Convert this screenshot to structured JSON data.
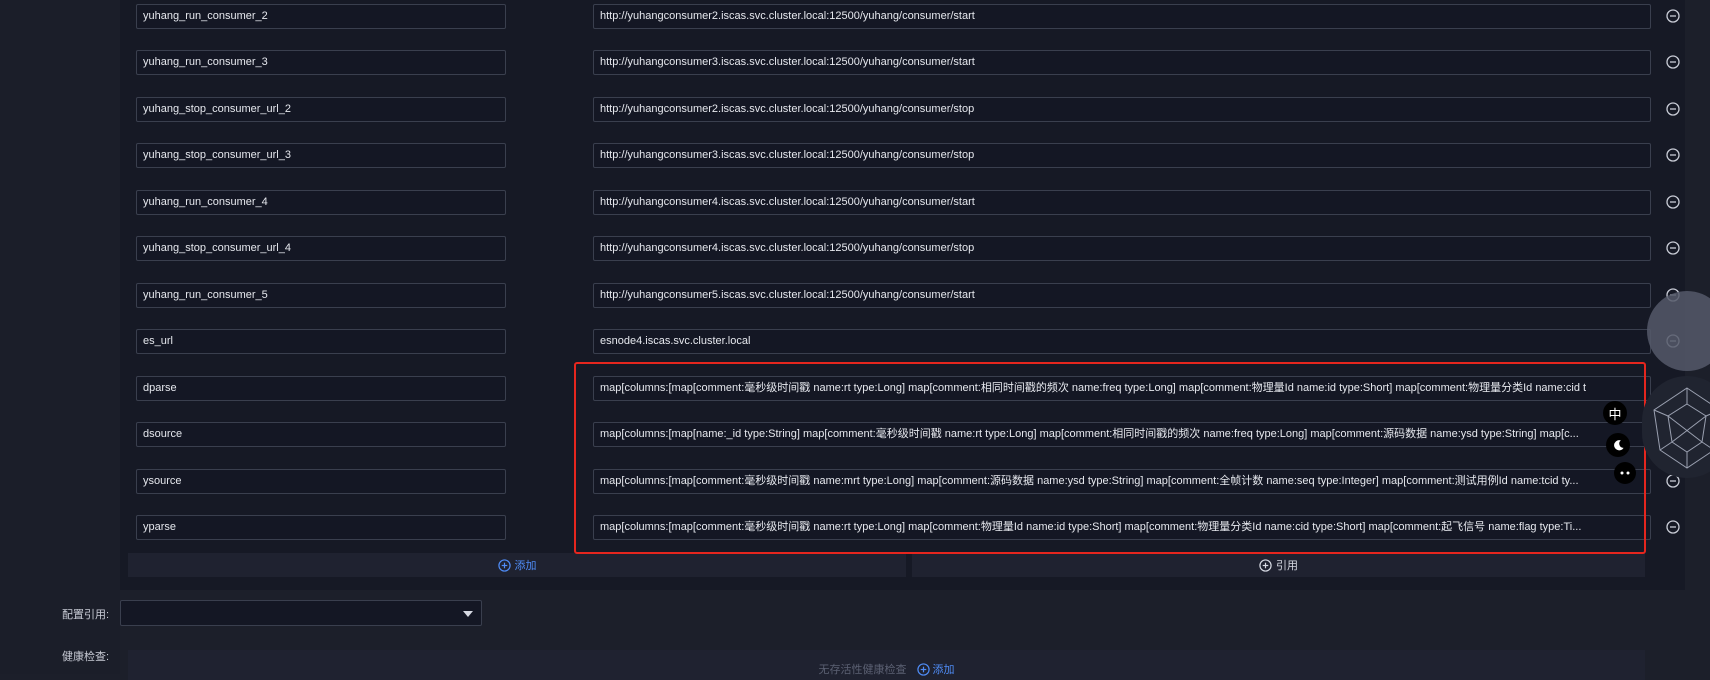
{
  "variables": [
    {
      "key": "yuhang_run_consumer_2",
      "value": "http://yuhangconsumer2.iscas.svc.cluster.local:12500/yuhang/consumer/start"
    },
    {
      "key": "yuhang_run_consumer_3",
      "value": "http://yuhangconsumer3.iscas.svc.cluster.local:12500/yuhang/consumer/start"
    },
    {
      "key": "yuhang_stop_consumer_url_2",
      "value": "http://yuhangconsumer2.iscas.svc.cluster.local:12500/yuhang/consumer/stop"
    },
    {
      "key": "yuhang_stop_consumer_url_3",
      "value": "http://yuhangconsumer3.iscas.svc.cluster.local:12500/yuhang/consumer/stop"
    },
    {
      "key": "yuhang_run_consumer_4",
      "value": "http://yuhangconsumer4.iscas.svc.cluster.local:12500/yuhang/consumer/start"
    },
    {
      "key": "yuhang_stop_consumer_url_4",
      "value": "http://yuhangconsumer4.iscas.svc.cluster.local:12500/yuhang/consumer/stop"
    },
    {
      "key": "yuhang_run_consumer_5",
      "value": "http://yuhangconsumer5.iscas.svc.cluster.local:12500/yuhang/consumer/start"
    },
    {
      "key": "es_url",
      "value": "esnode4.iscas.svc.cluster.local"
    },
    {
      "key": "dparse",
      "value": "map[columns:[map[comment:毫秒级时间戳 name:rt type:Long] map[comment:相同时间戳的频次 name:freq type:Long] map[comment:物理量Id name:id type:Short] map[comment:物理量分类Id name:cid t"
    },
    {
      "key": "dsource",
      "value": "map[columns:[map[name:_id type:String] map[comment:毫秒级时间戳 name:rt type:Long] map[comment:相同时间戳的频次 name:freq type:Long] map[comment:源码数据 name:ysd type:String] map[c..."
    },
    {
      "key": "ysource",
      "value": "map[columns:[map[comment:毫秒级时间戳 name:mrt type:Long] map[comment:源码数据 name:ysd type:String] map[comment:全帧计数 name:seq type:Integer] map[comment:测试用例Id name:tcid ty..."
    },
    {
      "key": "yparse",
      "value": "map[columns:[map[comment:毫秒级时间戳 name:rt type:Long] map[comment:物理量Id name:id type:Short] map[comment:物理量分类Id name:cid type:Short] map[comment:起飞信号 name:flag type:Ti..."
    }
  ],
  "actions": {
    "add_label": "添加",
    "reference_label": "引用"
  },
  "config_reference": {
    "label": "配置引用:",
    "value": ""
  },
  "health_check": {
    "label": "健康检查:",
    "empty_text": "无存活性健康检查",
    "add_label": "添加"
  },
  "floating_toolbar": {
    "lang_label": "中"
  },
  "colors": {
    "accent": "#4f8cf6",
    "highlight": "#e5261e",
    "background": "#161925"
  }
}
